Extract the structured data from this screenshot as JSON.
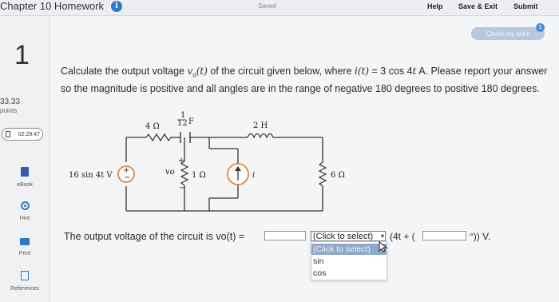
{
  "header": {
    "title": "Chapter 10 Homework",
    "saved_status": "Saved",
    "help": "Help",
    "save_exit": "Save & Exit",
    "submit": "Submit"
  },
  "question": {
    "number": "1",
    "points_value": "33.33",
    "points_label": "points",
    "timer": "02:29:47",
    "text_parts": [
      "Calculate the output voltage ",
      "v",
      "o",
      "(t)",
      " of the circuit given below, where ",
      "i(t)",
      " = 3 cos 4",
      "t",
      " A. Please report your answer so the magnitude is positive and all angles are in the range of negative 180 degrees to positive 180 degrees."
    ]
  },
  "sidebar": {
    "items": [
      {
        "label": "eBook",
        "icon": "ebook-icon"
      },
      {
        "label": "Hint",
        "icon": "hint-icon"
      },
      {
        "label": "Print",
        "icon": "print-icon"
      },
      {
        "label": "References",
        "icon": "references-icon"
      }
    ]
  },
  "check_work": {
    "label": "Check my work",
    "badge": "1"
  },
  "circuit": {
    "r1": "4 Ω",
    "cap_num": "1",
    "cap_den": "12",
    "cap_unit": "F",
    "inductor": "2 H",
    "source": "16 sin 4t V",
    "vo_label": "vo",
    "r2": "1 Ω",
    "current_label": "i",
    "r3": "6 Ω",
    "plus": "+",
    "minus": "−"
  },
  "answer": {
    "label": "The output voltage of the circuit is vo(t) =",
    "select_value": "(Click to select)",
    "options": [
      "(Click to select)",
      "sin",
      "cos"
    ],
    "after_select": "(4t + (",
    "end_text": "°)) V."
  },
  "colors": {
    "accent": "#2f79c7",
    "source_ring": "#e07a1f",
    "dropdown_highlight": "#8fa9c8"
  }
}
